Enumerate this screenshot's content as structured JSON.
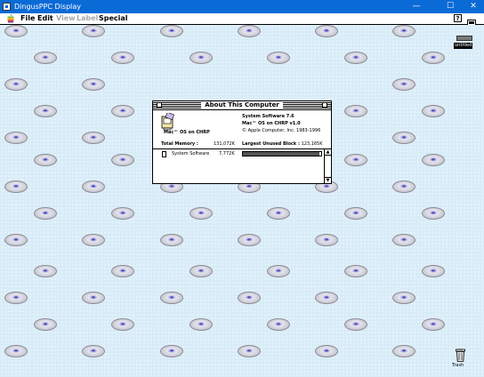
{
  "window": {
    "title": "DingusPPC Display"
  },
  "menubar": {
    "items": [
      {
        "label": "File",
        "enabled": true
      },
      {
        "label": "Edit",
        "enabled": true
      },
      {
        "label": "View",
        "enabled": false
      },
      {
        "label": "Label",
        "enabled": false
      },
      {
        "label": "Special",
        "enabled": true
      }
    ],
    "help_label": "?"
  },
  "desktop": {
    "hard_disk_label": "untitled",
    "trash_label": "Trash"
  },
  "about": {
    "title": "About This Computer",
    "os_name": "Mac™ OS on CHRP",
    "system_version": "System Software 7.6",
    "os_line": "Mac™ OS on CHRP v1.0",
    "copyright": "© Apple Computer, Inc. 1983-1996",
    "total_memory_label": "Total Memory :",
    "total_memory_value": "131,072K",
    "largest_block_label": "Largest Unused Block :",
    "largest_block_value": "123,165K",
    "apps": [
      {
        "name": "System Software",
        "size": "7,772K",
        "usage_fraction": 0.98
      }
    ]
  },
  "colors": {
    "titlebar": "#0a6ad6",
    "desktop": "#d8ecf8",
    "disc_center": "#5b55b5"
  },
  "icons": [
    "app-icon",
    "minimize-icon",
    "maximize-icon",
    "close-icon",
    "apple-menu-icon",
    "help-icon",
    "application-menu-icon",
    "hard-disk-icon",
    "trash-icon",
    "cd-disc-icon",
    "computer-icon",
    "memory-chip-icon"
  ]
}
